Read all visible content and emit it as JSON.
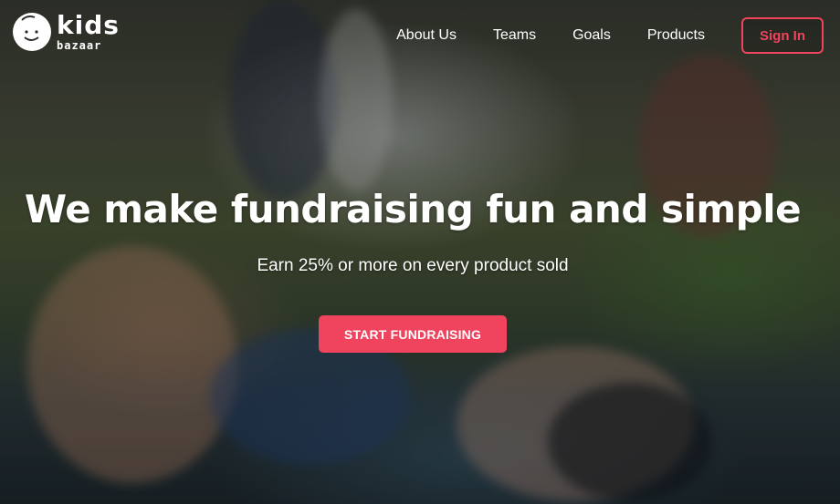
{
  "brand": {
    "name_top": "kids",
    "name_bottom": "bazaar"
  },
  "nav": {
    "items": [
      "About Us",
      "Teams",
      "Goals",
      "Products"
    ],
    "signin_label": "Sign In"
  },
  "hero": {
    "headline": "We make fundraising fun and simple",
    "subheadline": "Earn 25% or more on every product sold",
    "cta_label": "START FUNDRAISING"
  },
  "colors": {
    "accent": "#f0435d",
    "text": "#ffffff"
  }
}
